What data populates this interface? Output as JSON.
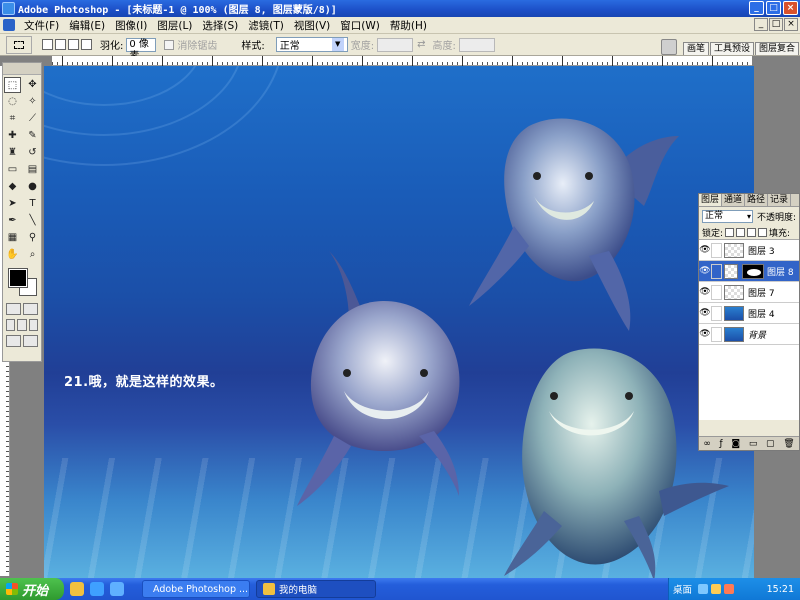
{
  "window": {
    "title": "Adobe Photoshop - [未标题-1 @ 100% (图层 8, 图层蒙版/8)]",
    "controls": [
      "_",
      "□",
      "×"
    ]
  },
  "menu": [
    "文件(F)",
    "编辑(E)",
    "图像(I)",
    "图层(L)",
    "选择(S)",
    "滤镜(T)",
    "视图(V)",
    "窗口(W)",
    "帮助(H)"
  ],
  "options": {
    "feather_label": "羽化:",
    "feather_value": "0 像素",
    "antialias_label": "消除锯齿",
    "style_label": "样式:",
    "style_value": "正常",
    "width_label": "宽度:",
    "height_label": "高度:",
    "well_tabs": [
      "画笔",
      "工具预设",
      "图层复合"
    ]
  },
  "canvas": {
    "caption": "21.哦，就是这样的效果。"
  },
  "layers_panel": {
    "tabs": [
      "图层",
      "通道",
      "路径",
      "记录"
    ],
    "blend_mode": "正常",
    "opacity_label": "不透明度:",
    "lock_label": "锁定:",
    "fill_label": "填充:",
    "layers": [
      {
        "name": "图层 3",
        "thumb": "checker",
        "selected": false,
        "italic": false
      },
      {
        "name": "图层 8",
        "thumb": "checker",
        "selected": true,
        "italic": false,
        "mask": true
      },
      {
        "name": "图层 7",
        "thumb": "checker",
        "selected": false,
        "italic": false
      },
      {
        "name": "图层 4",
        "thumb": "blue",
        "selected": false,
        "italic": false
      },
      {
        "name": "背景",
        "thumb": "blue",
        "selected": false,
        "italic": true
      }
    ]
  },
  "taskbar": {
    "start": "开始",
    "tasks": [
      "Adobe Photoshop ...",
      "我的电脑"
    ],
    "desktop": "桌面",
    "clock": "15:21"
  }
}
